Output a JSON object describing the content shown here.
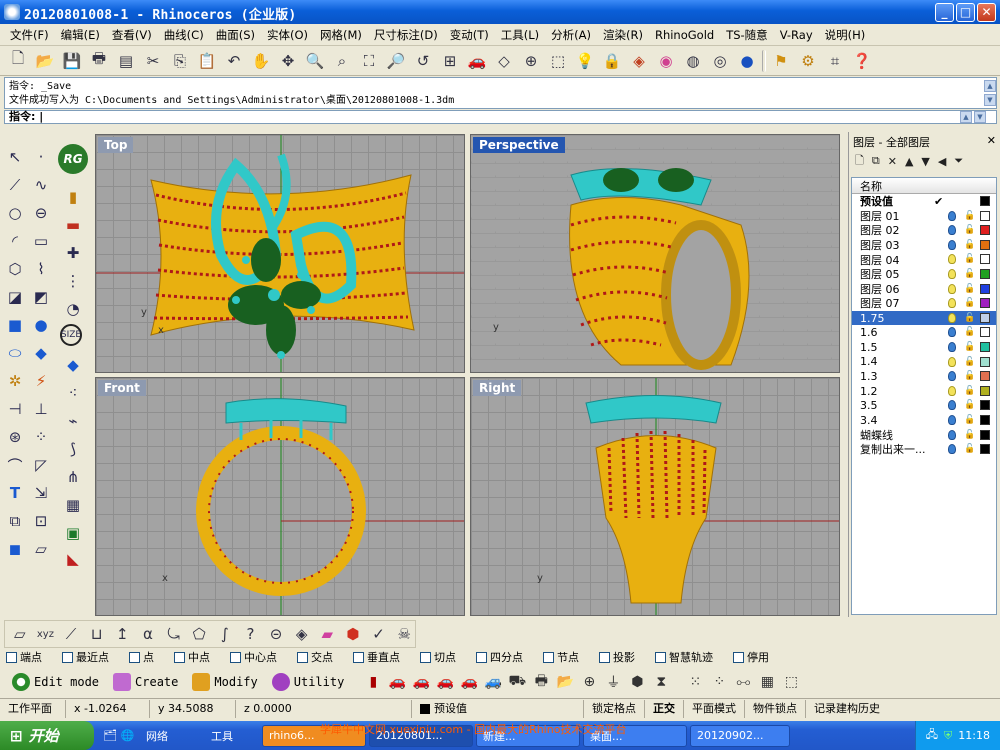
{
  "window": {
    "title": "20120801008-1 - Rhinoceros (企业版)",
    "minimize": "_",
    "maximize": "□",
    "close": "✕"
  },
  "menu": [
    "文件(F)",
    "编辑(E)",
    "查看(V)",
    "曲线(C)",
    "曲面(S)",
    "实体(O)",
    "网格(M)",
    "尺寸标注(D)",
    "变动(T)",
    "工具(L)",
    "分析(A)",
    "渲染(R)",
    "RhinoGold",
    "TS-随意",
    "V-Ray",
    "说明(H)"
  ],
  "command": {
    "history_line1": "指令: _Save",
    "history_line2": "文件成功写入为 C:\\Documents and Settings\\Administrator\\桌面\\20120801008-1.3dm",
    "prompt": "指令: |"
  },
  "viewports": {
    "top": "Top",
    "perspective": "Perspective",
    "front": "Front",
    "right": "Right"
  },
  "layers": {
    "panel_title": "图层 - 全部图层",
    "close": "✕",
    "column_name": "名称",
    "default_label": "预设值",
    "default_mark": "✔",
    "items": [
      {
        "name": "图层 01",
        "color": "#ffffff",
        "on": false
      },
      {
        "name": "图层 02",
        "color": "#e02020",
        "on": false
      },
      {
        "name": "图层 03",
        "color": "#e07010",
        "on": false
      },
      {
        "name": "图层 04",
        "color": "#ffffff",
        "on": true
      },
      {
        "name": "图层 05",
        "color": "#20a020",
        "on": true
      },
      {
        "name": "图层 06",
        "color": "#2040e0",
        "on": true
      },
      {
        "name": "图层 07",
        "color": "#a020c0",
        "on": true
      },
      {
        "name": "1.75",
        "color": "#c0d0e8",
        "on": true,
        "selected": true
      },
      {
        "name": "1.6",
        "color": "#ffffff",
        "on": false
      },
      {
        "name": "1.5",
        "color": "#20c0a0",
        "on": false
      },
      {
        "name": "1.4",
        "color": "#a0e0d0",
        "on": true
      },
      {
        "name": "1.3",
        "color": "#e07050",
        "on": false
      },
      {
        "name": "1.2",
        "color": "#b0b020",
        "on": true
      },
      {
        "name": "3.5",
        "color": "#000000",
        "on": false
      },
      {
        "name": "3.4",
        "color": "#000000",
        "on": false
      },
      {
        "name": "蝴蝶线",
        "color": "#000000",
        "on": false
      },
      {
        "name": "复制出来一...",
        "color": "#000000",
        "on": false
      }
    ]
  },
  "osnap": [
    "端点",
    "最近点",
    "点",
    "中点",
    "中心点",
    "交点",
    "垂直点",
    "切点",
    "四分点",
    "节点",
    "投影",
    "智慧轨迹",
    "停用"
  ],
  "tabs": {
    "edit": "Edit mode",
    "create": "Create",
    "modify": "Modify",
    "utility": "Utility"
  },
  "status": {
    "plane": "工作平面",
    "x": "x -1.0264",
    "y": "y 34.5088",
    "z": "z 0.0000",
    "layer": "预设值",
    "grid_snap": "锁定格点",
    "ortho": "正交",
    "planar": "平面模式",
    "osnap": "物件锁点",
    "history": "记录建构历史"
  },
  "taskbar": {
    "start": "开始",
    "items": [
      "网络",
      "工具",
      "rhino6...",
      "20120801...",
      "新建...",
      "桌面...",
      "20120902..."
    ],
    "clock": "11:18"
  },
  "watermark": "学犀牛中文网 xuexiniu.com - 国内最大的Rhino技术交流平台",
  "colors": {
    "ring_gold": "#e8b010",
    "stone_red": "#b01818",
    "setting_cyan": "#30c8c8",
    "gem_green": "#186020"
  }
}
